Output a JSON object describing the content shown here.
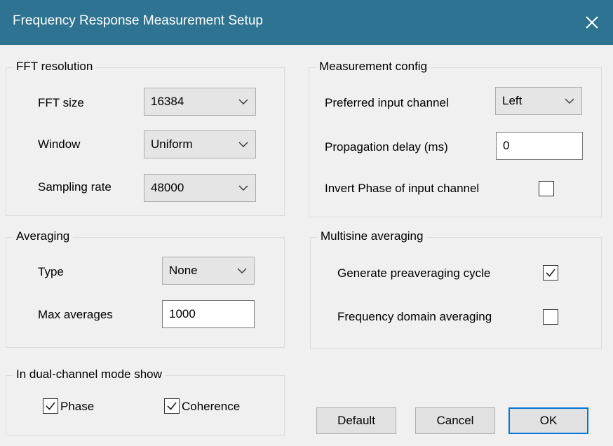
{
  "window": {
    "title": "Frequency Response Measurement Setup"
  },
  "fft_resolution": {
    "group_label": "FFT resolution",
    "fft_size": {
      "label": "FFT size",
      "value": "16384"
    },
    "window": {
      "label": "Window",
      "value": "Uniform"
    },
    "sampling_rate": {
      "label": "Sampling rate",
      "value": "48000"
    }
  },
  "measurement_config": {
    "group_label": "Measurement config",
    "preferred_input_channel": {
      "label": "Preferred input channel",
      "value": "Left"
    },
    "propagation_delay": {
      "label": "Propagation delay (ms)",
      "value": "0"
    },
    "invert_phase": {
      "label": "Invert Phase of input channel",
      "checked": false
    }
  },
  "averaging": {
    "group_label": "Averaging",
    "type": {
      "label": "Type",
      "value": "None"
    },
    "max_averages": {
      "label": "Max averages",
      "value": "1000"
    }
  },
  "multisine_averaging": {
    "group_label": "Multisine averaging",
    "generate_preaveraging_cycle": {
      "label": "Generate preaveraging cycle",
      "checked": true
    },
    "frequency_domain_averaging": {
      "label": "Frequency domain averaging",
      "checked": false
    }
  },
  "dual_channel": {
    "group_label": "In dual-channel mode show",
    "phase": {
      "label": "Phase",
      "checked": true
    },
    "coherence": {
      "label": "Coherence",
      "checked": true
    }
  },
  "buttons": {
    "default": "Default",
    "cancel": "Cancel",
    "ok": "OK"
  },
  "colors": {
    "titlebar": "#2e7391",
    "accent": "#0078d7"
  },
  "icons": {
    "close": "close-icon",
    "dropdown": "chevron-down-icon",
    "check": "checkmark-icon"
  }
}
